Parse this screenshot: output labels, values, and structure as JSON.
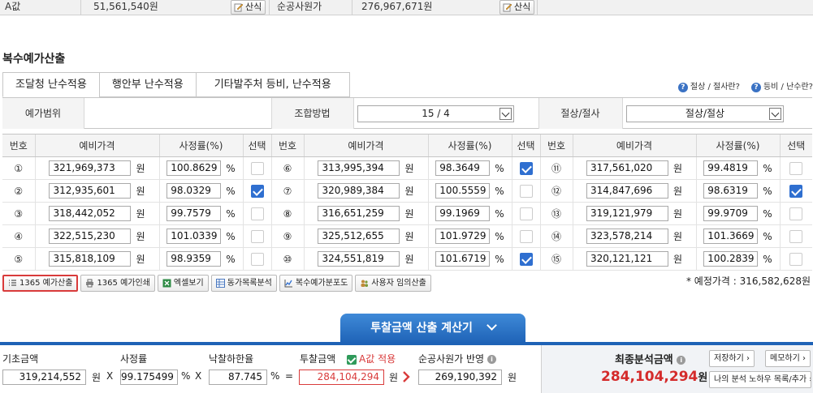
{
  "top": {
    "a_label": "A값",
    "a_value": "51,561,540원",
    "calc_label": "산식",
    "net_label": "순공사원가",
    "net_value": "276,967,671원"
  },
  "section_title": "복수예가산출",
  "tabs": [
    "조달청 난수적용",
    "행안부 난수적용",
    "기타발주처 등비, 난수적용"
  ],
  "help": {
    "link1": "절상 / 절사란?",
    "link2": "등비 / 난수란?"
  },
  "filter": {
    "range_label": "예가범위",
    "combo_label": "조합방법",
    "combo_value": "15 / 4",
    "round_label": "절상/절사",
    "round_value": "절상/절상"
  },
  "table": {
    "headers": {
      "no": "번호",
      "price": "예비가격",
      "rate": "사정률(%)",
      "select": "선택"
    },
    "unit_won": "원",
    "unit_pct": "%",
    "rows": [
      [
        {
          "no": "①",
          "price": "321,969,373",
          "rate": "100.8629",
          "sel": false
        },
        {
          "no": "⑥",
          "price": "313,995,394",
          "rate": "98.3649",
          "sel": true
        },
        {
          "no": "⑪",
          "price": "317,561,020",
          "rate": "99.4819",
          "sel": false
        }
      ],
      [
        {
          "no": "②",
          "price": "312,935,601",
          "rate": "98.0329",
          "sel": true
        },
        {
          "no": "⑦",
          "price": "320,989,384",
          "rate": "100.5559",
          "sel": false
        },
        {
          "no": "⑫",
          "price": "314,847,696",
          "rate": "98.6319",
          "sel": true
        }
      ],
      [
        {
          "no": "③",
          "price": "318,442,052",
          "rate": "99.7579",
          "sel": false
        },
        {
          "no": "⑧",
          "price": "316,651,259",
          "rate": "99.1969",
          "sel": false
        },
        {
          "no": "⑬",
          "price": "319,121,979",
          "rate": "99.9709",
          "sel": false
        }
      ],
      [
        {
          "no": "④",
          "price": "322,515,230",
          "rate": "101.0339",
          "sel": false
        },
        {
          "no": "⑨",
          "price": "325,512,655",
          "rate": "101.9729",
          "sel": false
        },
        {
          "no": "⑭",
          "price": "323,578,214",
          "rate": "101.3669",
          "sel": false
        }
      ],
      [
        {
          "no": "⑤",
          "price": "315,818,109",
          "rate": "98.9359",
          "sel": false
        },
        {
          "no": "⑩",
          "price": "324,551,819",
          "rate": "101.6719",
          "sel": true
        },
        {
          "no": "⑮",
          "price": "320,121,121",
          "rate": "100.2839",
          "sel": false
        }
      ]
    ]
  },
  "buttons": {
    "b1": "1365 예가산출",
    "b2": "1365 예가인쇄",
    "b3": "엑셀보기",
    "b4": "동가목록분석",
    "b5": "복수예가분포도",
    "b6": "사용자 임의산출"
  },
  "estimate": "* 예정가격 : 316,582,628원",
  "calc": {
    "tab_label": "투찰금액 산출 계산기",
    "base_label": "기초금액",
    "base_value": "319,214,552",
    "rate_label": "사정률",
    "rate_value": "99.175499",
    "limit_label": "낙찰하한율",
    "limit_value": "87.745",
    "bid_label": "투찰금액",
    "a_apply": "A값 적용",
    "bid_value": "284,104,294",
    "net_label": "순공사원가 반영",
    "net_value": "269,190,392",
    "won": "원",
    "x": "X",
    "pct": "%",
    "eq": "=",
    "final_label": "최종분석금액",
    "final_value": "284,104,294",
    "save_btn": "저장하기 ›",
    "memo_btn": "메모하기 ›",
    "list_btn": "나의 분석 노하우 목록/추가 ›"
  }
}
